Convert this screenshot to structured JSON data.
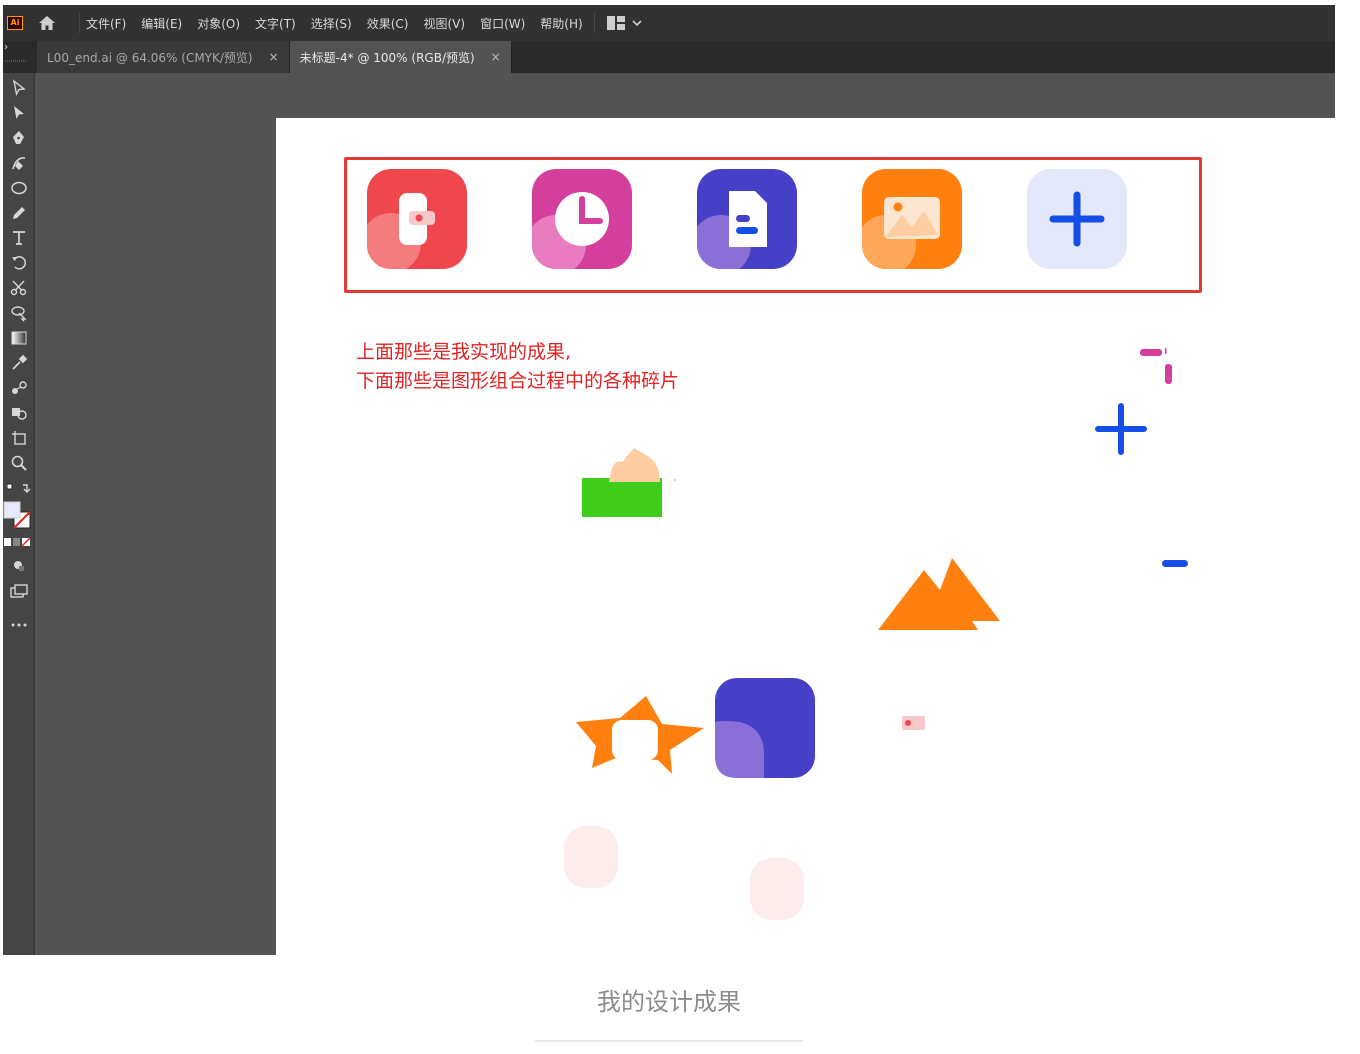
{
  "app": {
    "logo_text": "Ai",
    "accent": "#ff9a00"
  },
  "menu": {
    "items": [
      "文件(F)",
      "编辑(E)",
      "对象(O)",
      "文字(T)",
      "选择(S)",
      "效果(C)",
      "视图(V)",
      "窗口(W)",
      "帮助(H)"
    ]
  },
  "tabs": [
    {
      "label": "L00_end.ai @ 64.06% (CMYK/预览)",
      "active": false,
      "close": "×"
    },
    {
      "label": "未标题-4* @ 100% (RGB/预览)",
      "active": true,
      "close": "×"
    }
  ],
  "tools": [
    "selection-tool",
    "direct-selection-tool",
    "pen-tool",
    "curvature-tool",
    "ellipse-tool",
    "pencil-tool",
    "type-tool",
    "rotate-tool",
    "scissors-tool",
    "lasso-tool",
    "gradient-tool",
    "eyedropper-tool",
    "blend-tool",
    "symbol-sprayer-tool",
    "artboard-tool",
    "zoom-tool"
  ],
  "canvas": {
    "icons": [
      {
        "name": "wallet-icon",
        "color": "#f0474e"
      },
      {
        "name": "clock-icon",
        "color": "#d43f9e"
      },
      {
        "name": "document-icon",
        "color": "#4640c8"
      },
      {
        "name": "image-icon",
        "color": "#ff7f0f"
      },
      {
        "name": "plus-icon",
        "color": "#e4e8fb"
      }
    ],
    "note_lines": [
      "上面那些是我实现的成果,",
      "下面那些是图形组合过程中的各种碎片"
    ],
    "note_color": "#e02424"
  },
  "caption": "我的设计成果"
}
